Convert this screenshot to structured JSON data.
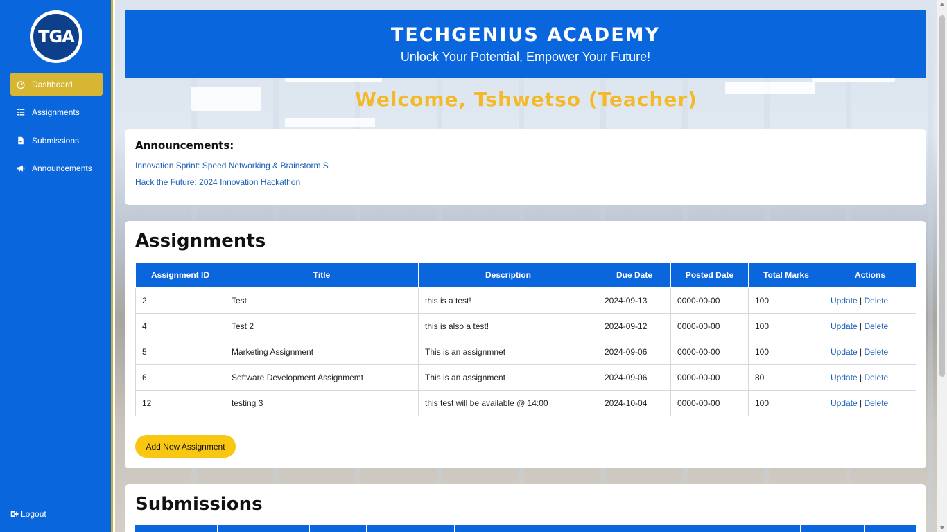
{
  "brand": {
    "logo_text": "TGA",
    "title": "TECHGENIUS ACADEMY",
    "tagline": "Unlock Your Potential, Empower Your Future!"
  },
  "colors": {
    "primary": "#0a66dc",
    "active_nav": "#d6b633",
    "welcome": "#f2b92a",
    "button": "#f9c712",
    "link": "#1a5fb8"
  },
  "sidebar": {
    "items": [
      {
        "label": "Dashboard",
        "icon": "gauge-icon",
        "active": true
      },
      {
        "label": "Assignments",
        "icon": "list-icon",
        "active": false
      },
      {
        "label": "Submissions",
        "icon": "file-icon",
        "active": false
      },
      {
        "label": "Announcements",
        "icon": "megaphone-icon",
        "active": false
      }
    ],
    "logout_label": "Logout"
  },
  "welcome": "Welcome, Tshwetso (Teacher)",
  "announcements": {
    "title": "Announcements:",
    "items": [
      "Innovation Sprint: Speed Networking & Brainstorm S",
      "Hack the Future: 2024 Innovation Hackathon"
    ]
  },
  "assignments": {
    "title": "Assignments",
    "columns": [
      "Assignment ID",
      "Title",
      "Description",
      "Due Date",
      "Posted Date",
      "Total Marks",
      "Actions"
    ],
    "rows": [
      {
        "id": "2",
        "title": "Test",
        "description": "this is a test!",
        "due": "2024-09-13",
        "posted": "0000-00-00",
        "marks": "100"
      },
      {
        "id": "4",
        "title": "Test 2",
        "description": "this is also a test!",
        "due": "2024-09-12",
        "posted": "0000-00-00",
        "marks": "100"
      },
      {
        "id": "5",
        "title": "Marketing Assignment",
        "description": "This is an assignmnet",
        "due": "2024-09-06",
        "posted": "0000-00-00",
        "marks": "100"
      },
      {
        "id": "6",
        "title": "Software Development Assignmemt",
        "description": "This is an assignment",
        "due": "2024-09-06",
        "posted": "0000-00-00",
        "marks": "80"
      },
      {
        "id": "12",
        "title": "testing 3",
        "description": "this test will be available @ 14:00",
        "due": "2024-10-04",
        "posted": "0000-00-00",
        "marks": "100"
      }
    ],
    "update_label": "Update",
    "separator": "|",
    "delete_label": "Delete",
    "add_button": "Add New Assignment"
  },
  "submissions": {
    "title": "Submissions"
  }
}
